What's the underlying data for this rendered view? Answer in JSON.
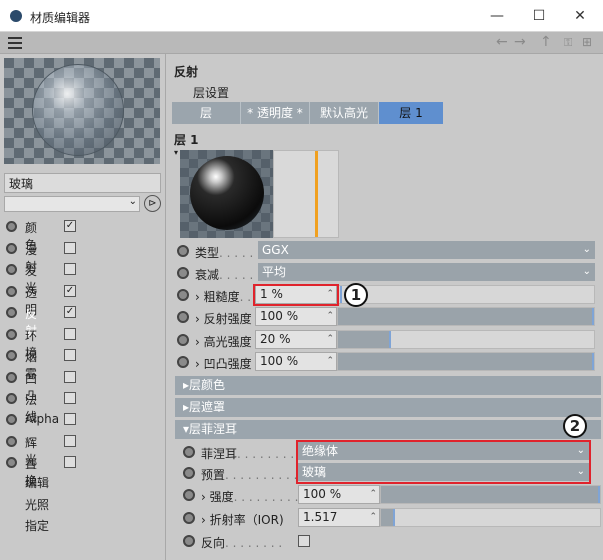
{
  "window": {
    "title": "材质编辑器",
    "minimize": "—",
    "maximize": "☐",
    "close": "✕"
  },
  "toolbar": {
    "back": "←",
    "forward": "→",
    "up": "↑",
    "lock": "🔒",
    "grid": "⊞"
  },
  "left": {
    "material_name": "玻璃",
    "channels": [
      {
        "label": "颜色",
        "checked": true
      },
      {
        "label": "漫射",
        "checked": false
      },
      {
        "label": "发光",
        "checked": false
      },
      {
        "label": "透明",
        "checked": true
      },
      {
        "label": "反射",
        "checked": true
      },
      {
        "label": "环境",
        "checked": false
      },
      {
        "label": "烟雾",
        "checked": false
      },
      {
        "label": "凹凸",
        "checked": false
      },
      {
        "label": "法线",
        "checked": false
      },
      {
        "label": "Alpha",
        "checked": false
      },
      {
        "label": "辉光",
        "checked": false
      },
      {
        "label": "置换",
        "checked": false
      }
    ],
    "links": [
      "编辑",
      "光照",
      "指定"
    ]
  },
  "right": {
    "section": "反射",
    "layer_settings": "层设置",
    "tabs": [
      {
        "label": "层",
        "active": false
      },
      {
        "label": "* 透明度 *",
        "active": false
      },
      {
        "label": "默认高光",
        "active": false
      },
      {
        "label": "层 1",
        "active": true
      }
    ],
    "layer_title": "层 1",
    "params": {
      "type": {
        "label": "类型",
        "value": "GGX"
      },
      "attenuation": {
        "label": "衰减",
        "value": "平均"
      },
      "roughness": {
        "label": "粗糙度",
        "value": "1 %",
        "fraction": 0.01
      },
      "reflect_strength": {
        "label": "反射强度",
        "value": "100 %",
        "fraction": 1.0
      },
      "specular_strength": {
        "label": "高光强度",
        "value": "20 %",
        "fraction": 0.2
      },
      "bump_strength": {
        "label": "凹凸强度",
        "value": "100 %",
        "fraction": 1.0
      }
    },
    "groups": {
      "layer_color": "层颜色",
      "layer_mask": "层遮罩",
      "layer_fresnel": "层菲涅耳"
    },
    "fresnel": {
      "fresnel_label": "菲涅耳",
      "fresnel_value": "绝缘体",
      "preset_label": "预置",
      "preset_value": "玻璃",
      "strength_label": "强度",
      "strength_value": "100 %",
      "strength_fraction": 1.0,
      "ior_label": "折射率（IOR)",
      "ior_value": "1.517",
      "invert_label": "反向"
    }
  },
  "annotations": {
    "badge1": "1",
    "badge2": "2"
  },
  "colors": {
    "accent": "#5f8fcf",
    "highlight_red": "#e0232c",
    "bar": "#9aa3aa"
  }
}
